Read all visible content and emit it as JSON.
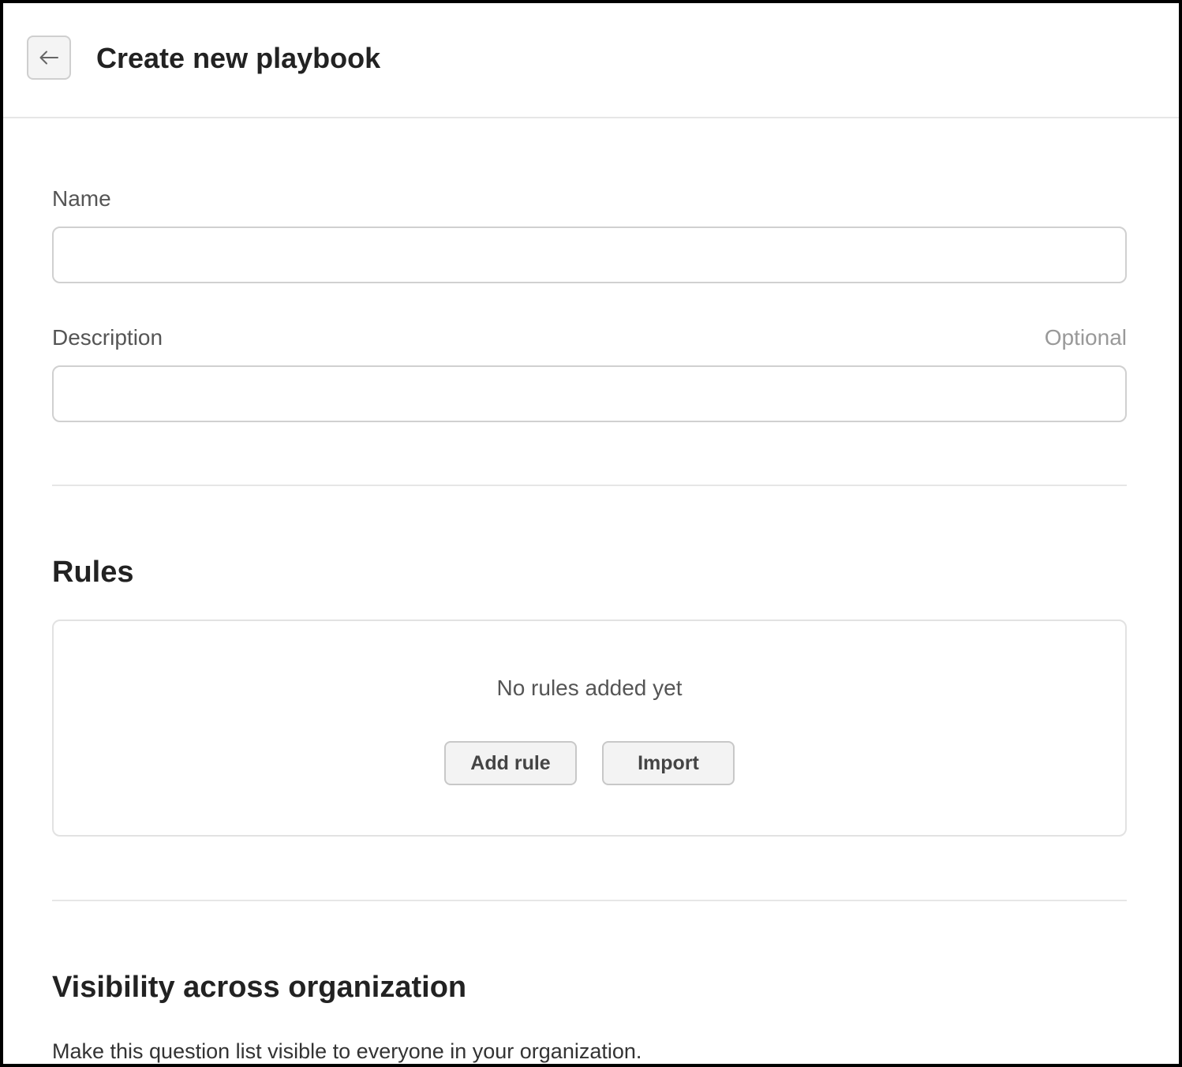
{
  "header": {
    "back_icon": "arrow-left-icon",
    "title": "Create new playbook"
  },
  "form": {
    "name": {
      "label": "Name",
      "value": "",
      "placeholder": ""
    },
    "description": {
      "label": "Description",
      "optional_label": "Optional",
      "value": "",
      "placeholder": ""
    }
  },
  "rules": {
    "title": "Rules",
    "empty_text": "No rules added yet",
    "add_rule_label": "Add rule",
    "import_label": "Import"
  },
  "visibility": {
    "title": "Visibility across organization",
    "description": "Make this question list visible to everyone in your organization."
  }
}
